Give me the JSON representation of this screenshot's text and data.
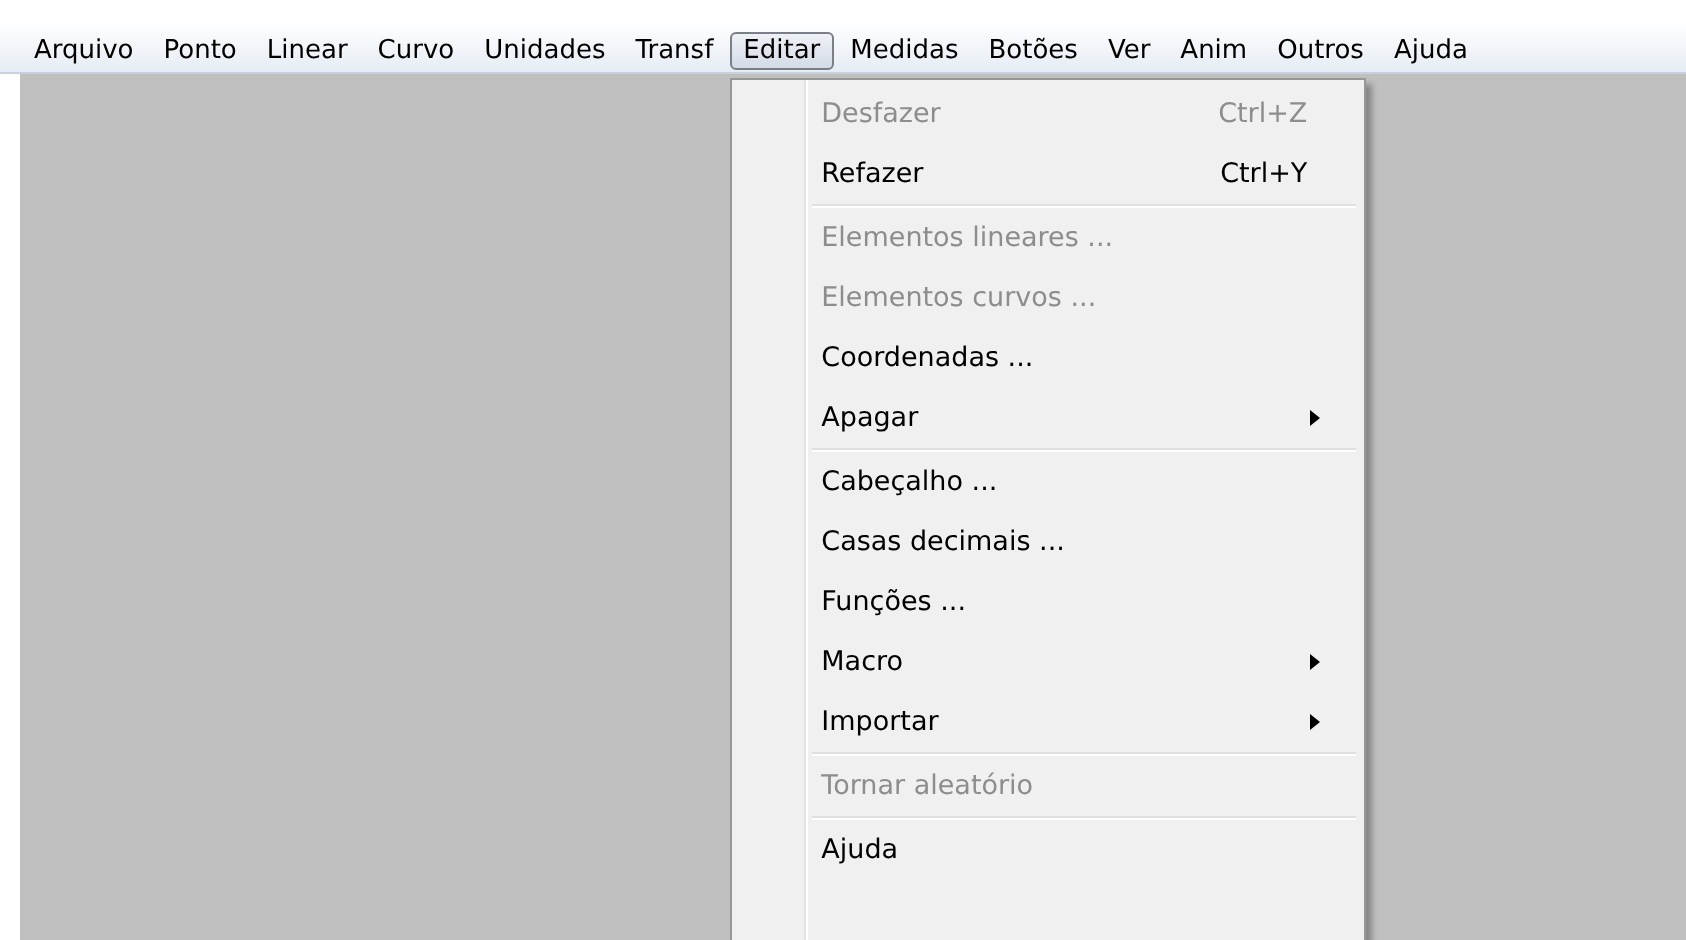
{
  "menubar": [
    {
      "label": "Arquivo",
      "selected": false
    },
    {
      "label": "Ponto",
      "selected": false
    },
    {
      "label": "Linear",
      "selected": false
    },
    {
      "label": "Curvo",
      "selected": false
    },
    {
      "label": "Unidades",
      "selected": false
    },
    {
      "label": "Transf",
      "selected": false
    },
    {
      "label": "Editar",
      "selected": true
    },
    {
      "label": "Medidas",
      "selected": false
    },
    {
      "label": "Botões",
      "selected": false
    },
    {
      "label": "Ver",
      "selected": false
    },
    {
      "label": "Anim",
      "selected": false
    },
    {
      "label": "Outros",
      "selected": false
    },
    {
      "label": "Ajuda",
      "selected": false
    }
  ],
  "menu": {
    "items": [
      {
        "kind": "item",
        "label": "Desfazer",
        "shortcut": "Ctrl+Z",
        "disabled": true,
        "submenu": false
      },
      {
        "kind": "item",
        "label": "Refazer",
        "shortcut": "Ctrl+Y",
        "disabled": false,
        "submenu": false
      },
      {
        "kind": "separator"
      },
      {
        "kind": "item",
        "label": "Elementos lineares ...",
        "disabled": true,
        "submenu": false
      },
      {
        "kind": "item",
        "label": "Elementos curvos ...",
        "disabled": true,
        "submenu": false
      },
      {
        "kind": "item",
        "label": "Coordenadas ...",
        "disabled": false,
        "submenu": false
      },
      {
        "kind": "item",
        "label": "Apagar",
        "disabled": false,
        "submenu": true
      },
      {
        "kind": "separator"
      },
      {
        "kind": "item",
        "label": "Cabeçalho ...",
        "disabled": false,
        "submenu": false
      },
      {
        "kind": "item",
        "label": "Casas decimais ...",
        "disabled": false,
        "submenu": false
      },
      {
        "kind": "item",
        "label": "Funções ...",
        "disabled": false,
        "submenu": false
      },
      {
        "kind": "item",
        "label": "Macro",
        "disabled": false,
        "submenu": true
      },
      {
        "kind": "item",
        "label": "Importar",
        "disabled": false,
        "submenu": true
      },
      {
        "kind": "separator"
      },
      {
        "kind": "item",
        "label": "Tornar aleatório",
        "disabled": true,
        "submenu": false
      },
      {
        "kind": "separator"
      },
      {
        "kind": "item",
        "label": "Ajuda",
        "disabled": false,
        "submenu": false
      }
    ]
  }
}
